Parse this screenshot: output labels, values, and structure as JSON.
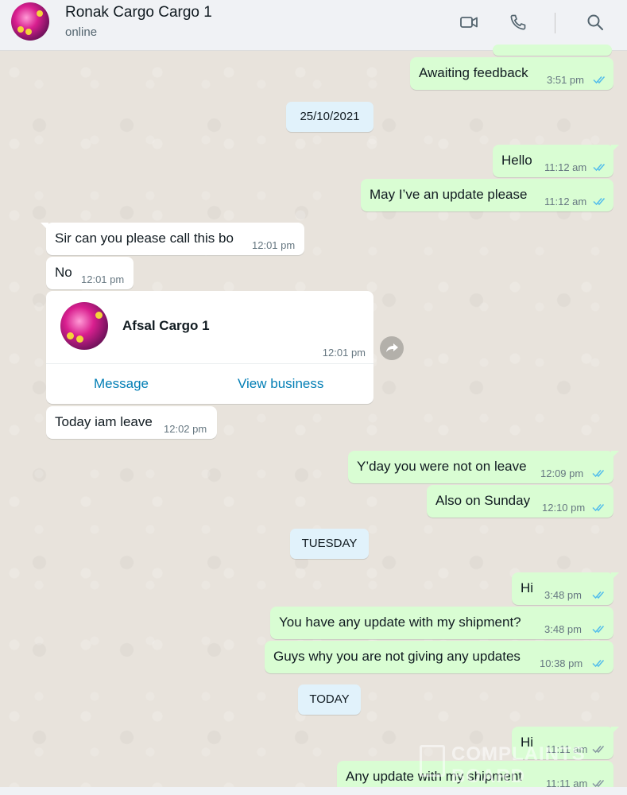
{
  "header": {
    "name": "Ronak Cargo Cargo 1",
    "status": "online",
    "icons": [
      "video-call-icon",
      "voice-call-icon",
      "search-icon"
    ]
  },
  "dates": {
    "d1": "25/10/2021",
    "d2": "TUESDAY",
    "d3": "TODAY"
  },
  "messages": [
    {
      "dir": "out",
      "text": "Awaiting feedback",
      "time": "3:51 pm",
      "status": "read"
    },
    {
      "dir": "out",
      "text": "Hello",
      "time": "11:12 am",
      "status": "read"
    },
    {
      "dir": "out",
      "text": "May I’ve an update please",
      "time": "11:12 am",
      "status": "read"
    },
    {
      "dir": "in",
      "text": "Sir can you please call this bo",
      "time": "12:01 pm"
    },
    {
      "dir": "in",
      "text": "No",
      "time": "12:01 pm"
    },
    {
      "dir": "in",
      "text": "Today iam leave",
      "time": "12:02 pm"
    },
    {
      "dir": "out",
      "text": "Y’day you were not on leave",
      "time": "12:09 pm",
      "status": "read"
    },
    {
      "dir": "out",
      "text": "Also on Sunday",
      "time": "12:10 pm",
      "status": "read"
    },
    {
      "dir": "out",
      "text": "Hi",
      "time": "3:48 pm",
      "status": "read"
    },
    {
      "dir": "out",
      "text": "You have any update with my shipment?",
      "time": "3:48 pm",
      "status": "read"
    },
    {
      "dir": "out",
      "text": "Guys why you are not giving any updates",
      "time": "10:38 pm",
      "status": "read"
    },
    {
      "dir": "out",
      "text": "Hi",
      "time": "11:11 am",
      "status": "delivered"
    },
    {
      "dir": "out",
      "text": "Any update with my shipment",
      "time": "11:11 am",
      "status": "delivered"
    }
  ],
  "contact_card": {
    "name": "Afsal Cargo 1",
    "time": "12:01 pm",
    "message_label": "Message",
    "view_label": "View business"
  },
  "watermark": "COMPLAINTS BOARD",
  "colors": {
    "outgoing_bubble": "#d9fdd3",
    "incoming_bubble": "#ffffff",
    "read_ticks": "#53bdeb",
    "delivered_ticks": "#8696a0",
    "link": "#027eb5"
  }
}
